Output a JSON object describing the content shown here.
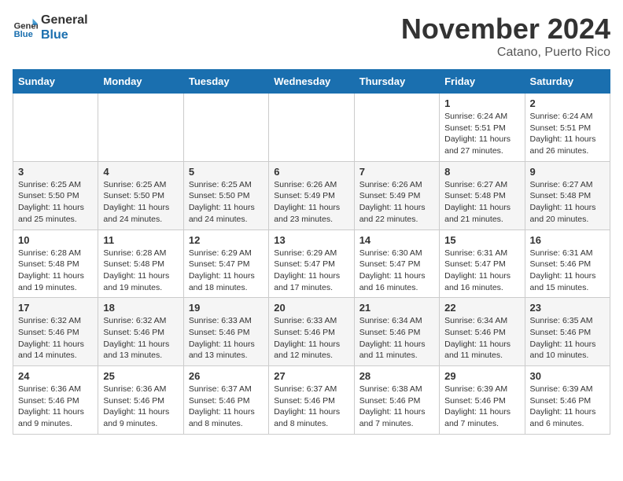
{
  "header": {
    "logo_general": "General",
    "logo_blue": "Blue",
    "month_title": "November 2024",
    "location": "Catano, Puerto Rico"
  },
  "weekdays": [
    "Sunday",
    "Monday",
    "Tuesday",
    "Wednesday",
    "Thursday",
    "Friday",
    "Saturday"
  ],
  "weeks": [
    [
      {
        "day": "",
        "info": ""
      },
      {
        "day": "",
        "info": ""
      },
      {
        "day": "",
        "info": ""
      },
      {
        "day": "",
        "info": ""
      },
      {
        "day": "",
        "info": ""
      },
      {
        "day": "1",
        "info": "Sunrise: 6:24 AM\nSunset: 5:51 PM\nDaylight: 11 hours\nand 27 minutes."
      },
      {
        "day": "2",
        "info": "Sunrise: 6:24 AM\nSunset: 5:51 PM\nDaylight: 11 hours\nand 26 minutes."
      }
    ],
    [
      {
        "day": "3",
        "info": "Sunrise: 6:25 AM\nSunset: 5:50 PM\nDaylight: 11 hours\nand 25 minutes."
      },
      {
        "day": "4",
        "info": "Sunrise: 6:25 AM\nSunset: 5:50 PM\nDaylight: 11 hours\nand 24 minutes."
      },
      {
        "day": "5",
        "info": "Sunrise: 6:25 AM\nSunset: 5:50 PM\nDaylight: 11 hours\nand 24 minutes."
      },
      {
        "day": "6",
        "info": "Sunrise: 6:26 AM\nSunset: 5:49 PM\nDaylight: 11 hours\nand 23 minutes."
      },
      {
        "day": "7",
        "info": "Sunrise: 6:26 AM\nSunset: 5:49 PM\nDaylight: 11 hours\nand 22 minutes."
      },
      {
        "day": "8",
        "info": "Sunrise: 6:27 AM\nSunset: 5:48 PM\nDaylight: 11 hours\nand 21 minutes."
      },
      {
        "day": "9",
        "info": "Sunrise: 6:27 AM\nSunset: 5:48 PM\nDaylight: 11 hours\nand 20 minutes."
      }
    ],
    [
      {
        "day": "10",
        "info": "Sunrise: 6:28 AM\nSunset: 5:48 PM\nDaylight: 11 hours\nand 19 minutes."
      },
      {
        "day": "11",
        "info": "Sunrise: 6:28 AM\nSunset: 5:48 PM\nDaylight: 11 hours\nand 19 minutes."
      },
      {
        "day": "12",
        "info": "Sunrise: 6:29 AM\nSunset: 5:47 PM\nDaylight: 11 hours\nand 18 minutes."
      },
      {
        "day": "13",
        "info": "Sunrise: 6:29 AM\nSunset: 5:47 PM\nDaylight: 11 hours\nand 17 minutes."
      },
      {
        "day": "14",
        "info": "Sunrise: 6:30 AM\nSunset: 5:47 PM\nDaylight: 11 hours\nand 16 minutes."
      },
      {
        "day": "15",
        "info": "Sunrise: 6:31 AM\nSunset: 5:47 PM\nDaylight: 11 hours\nand 16 minutes."
      },
      {
        "day": "16",
        "info": "Sunrise: 6:31 AM\nSunset: 5:46 PM\nDaylight: 11 hours\nand 15 minutes."
      }
    ],
    [
      {
        "day": "17",
        "info": "Sunrise: 6:32 AM\nSunset: 5:46 PM\nDaylight: 11 hours\nand 14 minutes."
      },
      {
        "day": "18",
        "info": "Sunrise: 6:32 AM\nSunset: 5:46 PM\nDaylight: 11 hours\nand 13 minutes."
      },
      {
        "day": "19",
        "info": "Sunrise: 6:33 AM\nSunset: 5:46 PM\nDaylight: 11 hours\nand 13 minutes."
      },
      {
        "day": "20",
        "info": "Sunrise: 6:33 AM\nSunset: 5:46 PM\nDaylight: 11 hours\nand 12 minutes."
      },
      {
        "day": "21",
        "info": "Sunrise: 6:34 AM\nSunset: 5:46 PM\nDaylight: 11 hours\nand 11 minutes."
      },
      {
        "day": "22",
        "info": "Sunrise: 6:34 AM\nSunset: 5:46 PM\nDaylight: 11 hours\nand 11 minutes."
      },
      {
        "day": "23",
        "info": "Sunrise: 6:35 AM\nSunset: 5:46 PM\nDaylight: 11 hours\nand 10 minutes."
      }
    ],
    [
      {
        "day": "24",
        "info": "Sunrise: 6:36 AM\nSunset: 5:46 PM\nDaylight: 11 hours\nand 9 minutes."
      },
      {
        "day": "25",
        "info": "Sunrise: 6:36 AM\nSunset: 5:46 PM\nDaylight: 11 hours\nand 9 minutes."
      },
      {
        "day": "26",
        "info": "Sunrise: 6:37 AM\nSunset: 5:46 PM\nDaylight: 11 hours\nand 8 minutes."
      },
      {
        "day": "27",
        "info": "Sunrise: 6:37 AM\nSunset: 5:46 PM\nDaylight: 11 hours\nand 8 minutes."
      },
      {
        "day": "28",
        "info": "Sunrise: 6:38 AM\nSunset: 5:46 PM\nDaylight: 11 hours\nand 7 minutes."
      },
      {
        "day": "29",
        "info": "Sunrise: 6:39 AM\nSunset: 5:46 PM\nDaylight: 11 hours\nand 7 minutes."
      },
      {
        "day": "30",
        "info": "Sunrise: 6:39 AM\nSunset: 5:46 PM\nDaylight: 11 hours\nand 6 minutes."
      }
    ]
  ]
}
